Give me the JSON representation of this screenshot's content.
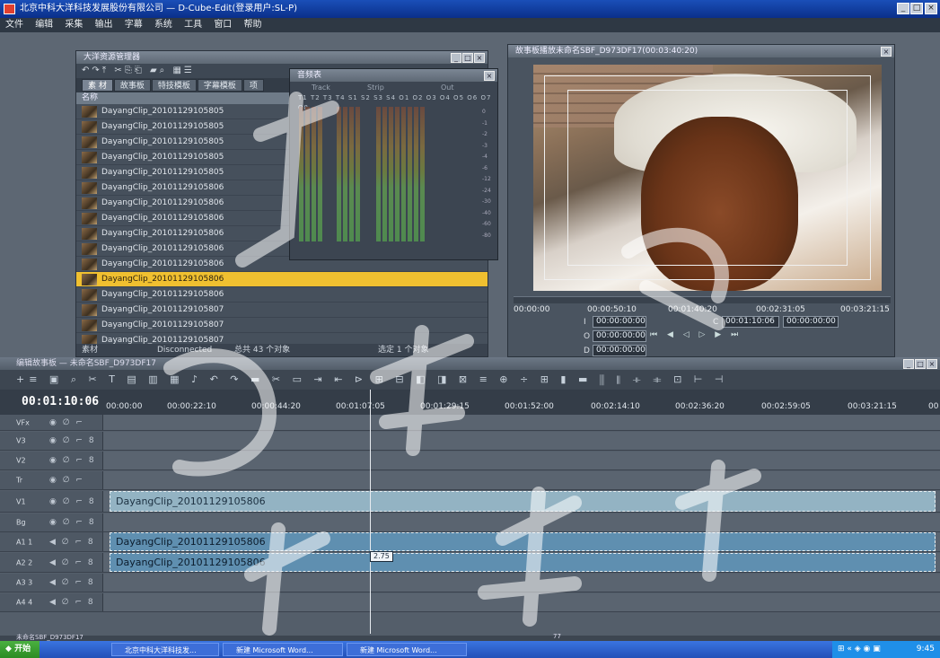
{
  "window": {
    "title": "北京中科大洋科技发展股份有限公司 — D-Cube-Edit(登录用户:SL-P)"
  },
  "menu": [
    "文件",
    "编辑",
    "采集",
    "输出",
    "字幕",
    "系统",
    "工具",
    "窗口",
    "帮助"
  ],
  "resource_manager": {
    "title": "大洋资源管理器",
    "tabs": [
      "素 材",
      "故事板",
      "特技模板",
      "字幕模板",
      "项"
    ],
    "column_name": "名称",
    "clips": [
      "DayangClip_20101129105805",
      "DayangClip_20101129105805",
      "DayangClip_20101129105805",
      "DayangClip_20101129105805",
      "DayangClip_20101129105805",
      "DayangClip_20101129105806",
      "DayangClip_20101129105806",
      "DayangClip_20101129105806",
      "DayangClip_20101129105806",
      "DayangClip_20101129105806",
      "DayangClip_20101129105806",
      "DayangClip_20101129105806",
      "DayangClip_20101129105806",
      "DayangClip_20101129105807",
      "DayangClip_20101129105807",
      "DayangClip_20101129105807"
    ],
    "selected_index": 11,
    "status": {
      "tab": "素材",
      "connection": "Disconnected",
      "total": "总共 43 个对象",
      "selected": "选定 1 个对象"
    }
  },
  "audio_meter": {
    "title": "音频表",
    "groups": [
      "Track",
      "Strip",
      "Out"
    ],
    "channels": "T1 T2 T3 T4   S1 S2 S3 S4   O1 O2 O3 O4 O5 O6 O7 O8",
    "scale": [
      "0",
      "-1",
      "-2",
      "-3",
      "-4",
      "-6",
      "-12",
      "-24",
      "-30",
      "-40",
      "-60",
      "-80"
    ]
  },
  "player": {
    "title": "故事板播放未命名SBF_D973DF17(00:03:40:20)",
    "scrub_times": [
      "00:00:00",
      "00:00:50:10",
      "00:01:40:20",
      "00:02:31:05",
      "00:03:21:15"
    ],
    "tc_in": "00:00:00:00",
    "tc_out": "00:00:00:00",
    "tc_dur": "00:00:00:00",
    "tc_current": "00:01:10:06",
    "tc_extra": "00:00:00:00",
    "labels": {
      "in": "I",
      "out": "O",
      "dur": "D",
      "cur": "C"
    }
  },
  "editor": {
    "title": "编辑故事板 — 未命名SBF_D973DF17",
    "timecode": "00:01:10:06",
    "ruler": [
      "00:00:00",
      "00:00:22:10",
      "00:00:44:20",
      "00:01:07:05",
      "00:01:29:15",
      "00:01:52:00",
      "00:02:14:10",
      "00:02:36:20",
      "00:02:59:05",
      "00:03:21:15",
      "00"
    ],
    "tracks": [
      {
        "name": "VFx",
        "icons": "◉ ∅ ⌐"
      },
      {
        "name": "V3",
        "icons": "◉ ∅ ⌐ 8"
      },
      {
        "name": "V2",
        "icons": "◉ ∅ ⌐ 8"
      },
      {
        "name": "Tr",
        "icons": "◉ ∅ ⌐"
      },
      {
        "name": "V1",
        "icons": "◉ ∅ ⌐ 8",
        "clip": "DayangClip_20101129105806"
      },
      {
        "name": "Bg",
        "icons": "◉ ∅ ⌐ 8"
      },
      {
        "name": "A1  1",
        "icons": "◀ ∅ ⌐ 8",
        "clip": "DayangClip_20101129105806"
      },
      {
        "name": "A2  2",
        "icons": "◀ ∅ ⌐ 8",
        "clip": "DayangClip_20101129105806"
      },
      {
        "name": "A3  3",
        "icons": "◀ ∅ ⌐ 8"
      },
      {
        "name": "A4  4",
        "icons": "◀ ∅ ⌐ 8"
      }
    ],
    "keyframe_value": "2.75",
    "status_tab": "未命名SBF_D973DF17",
    "status_num": "77"
  },
  "taskbar": {
    "start": "开始",
    "tasks": [
      "北京中科大洋科技发...",
      "新建 Microsoft Word...",
      "新建 Microsoft Word..."
    ],
    "clock": "9:45"
  },
  "colors": {
    "accent": "#f0c030",
    "title_blue": "#0a2f8a"
  }
}
